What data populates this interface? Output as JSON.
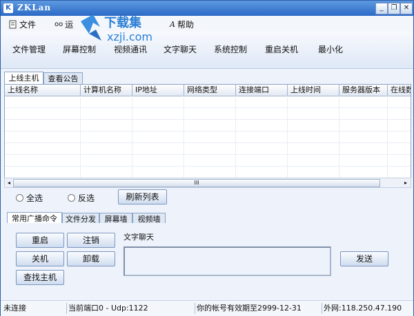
{
  "window": {
    "title": "ZKLan",
    "icon_letter": "K",
    "controls": [
      "_",
      "❐",
      "✕"
    ]
  },
  "menu": [
    {
      "label": "文件",
      "icon": "file-icon"
    },
    {
      "label": "运",
      "icon": "glasses-icon"
    },
    {
      "label": "帮助",
      "icon": "help-icon"
    }
  ],
  "watermark": {
    "top": "下载集",
    "bottom": "xzji.com"
  },
  "toolbar": [
    "文件管理",
    "屏幕控制",
    "视频通讯",
    "文字聊天",
    "系统控制",
    "重启关机",
    "最小化"
  ],
  "main_tabs": [
    "上线主机",
    "查看公告"
  ],
  "columns": [
    "上线名称",
    "计算机名称",
    "IP地址",
    "网络类型",
    "连接端口",
    "上线时间",
    "服务器版本",
    "在线数"
  ],
  "scrollbar": {
    "thumb": "III",
    "left_arrow": "◂",
    "right_arrow": "▸"
  },
  "selection": {
    "select_all": "全选",
    "invert": "反选",
    "refresh": "刷新列表"
  },
  "cmd_tabs": [
    "常用广播命令",
    "文件分发",
    "屏幕墙",
    "视频墙"
  ],
  "commands": {
    "restart": "重启",
    "logout": "注销",
    "shutdown": "关机",
    "uninstall": "卸载",
    "find": "查找主机"
  },
  "chat": {
    "label": "文字聊天",
    "send": "发送"
  },
  "status": {
    "connection": "未连接",
    "port": "当前端口0 - Udp:1122",
    "expiry": "你的帐号有效期至2999-12-31",
    "external_ip": "外网:118.250.47.190"
  }
}
